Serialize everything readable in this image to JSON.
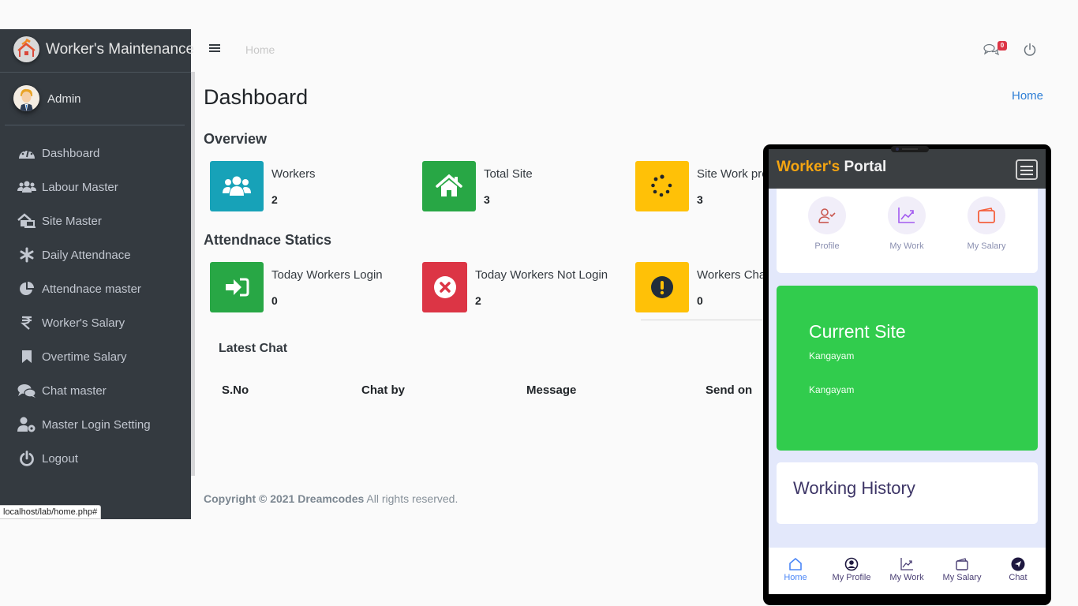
{
  "sidebar": {
    "brand": "Worker's Maintenance",
    "user": "Admin",
    "items": [
      {
        "label": "Dashboard",
        "icon": "tachometer-icon"
      },
      {
        "label": "Labour Master",
        "icon": "users-icon"
      },
      {
        "label": "Site Master",
        "icon": "home-laptop-icon"
      },
      {
        "label": "Daily Attendnace",
        "icon": "asterisk-icon"
      },
      {
        "label": "Attendnace master",
        "icon": "pie-chart-icon"
      },
      {
        "label": "Worker's Salary",
        "icon": "rupee-icon"
      },
      {
        "label": "Overtime Salary",
        "icon": "bookmark-icon"
      },
      {
        "label": "Chat master",
        "icon": "comments-icon"
      },
      {
        "label": "Master Login Setting",
        "icon": "user-cog-icon"
      },
      {
        "label": "Logout",
        "icon": "power-icon"
      }
    ]
  },
  "status_bar": {
    "url": "localhost/lab/home.php#"
  },
  "topbar": {
    "home_link": "Home",
    "chat_badge": "0"
  },
  "content": {
    "title": "Dashboard",
    "breadcrumb": "Home",
    "overview_title": "Overview",
    "overview": [
      {
        "label": "Workers",
        "value": "2",
        "color": "#17a2b8",
        "icon": "users-icon"
      },
      {
        "label": "Total Site",
        "value": "3",
        "color": "#28a745",
        "icon": "house-icon"
      },
      {
        "label": "Site Work pro",
        "value": "3",
        "color": "#ffc107",
        "icon": "spinner-icon"
      }
    ],
    "attendance_title": "Attendnace Statics",
    "attendance": [
      {
        "label": "Today Workers Login",
        "value": "0",
        "color": "#28a745",
        "icon": "sign-in-icon"
      },
      {
        "label": "Today Workers Not Login",
        "value": "2",
        "color": "#dc3545",
        "icon": "times-circle-icon"
      },
      {
        "label": "Workers Chat",
        "value": "0",
        "color": "#ffc107",
        "icon": "exclamation-circle-icon"
      }
    ],
    "latest_chat": {
      "title": "Latest Chat",
      "columns": [
        "S.No",
        "Chat by",
        "Message",
        "Send on"
      ],
      "rows": []
    },
    "footer": {
      "bold": "Copyright © 2021 Dreamcodes",
      "rest": " All rights reserved."
    }
  },
  "phone": {
    "brand_part1": "Worker's",
    "brand_part2": " Portal",
    "quick_links": [
      {
        "label": "Profile",
        "icon": "user-check-icon"
      },
      {
        "label": "My Work",
        "icon": "trend-chart-icon"
      },
      {
        "label": "My Salary",
        "icon": "wallet-icon"
      }
    ],
    "current_site": {
      "title": "Current Site",
      "line1": "Kangayam",
      "line2": "Kangayam"
    },
    "history_title": "Working History",
    "tabs": [
      {
        "label": "Home",
        "icon": "home-icon",
        "active": true
      },
      {
        "label": "My Profile",
        "icon": "user-circle-icon"
      },
      {
        "label": "My Work",
        "icon": "trend-chart-icon"
      },
      {
        "label": "My Salary",
        "icon": "wallet-icon"
      },
      {
        "label": "Chat",
        "icon": "send-icon"
      }
    ]
  }
}
